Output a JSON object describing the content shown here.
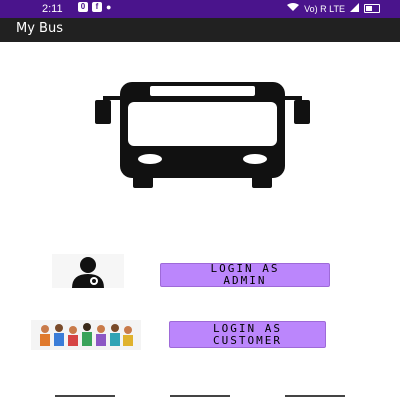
{
  "status_bar": {
    "time": "2:11",
    "left_badges": [
      "0",
      "f",
      "●"
    ],
    "right_text": "Vo) R LTE"
  },
  "app_bar": {
    "title": "My Bus"
  },
  "buttons": {
    "admin_label": "LOGIN AS\nADMIN",
    "customer_label": "LOGIN AS\nCUSTOMER"
  },
  "icons": {
    "hero": "bus-front-icon",
    "admin": "admin-user-icon",
    "customer": "customer-group-icon"
  },
  "colors": {
    "status_bar": "#4a148c",
    "app_bar": "#212121",
    "button": "#bb86fc"
  }
}
